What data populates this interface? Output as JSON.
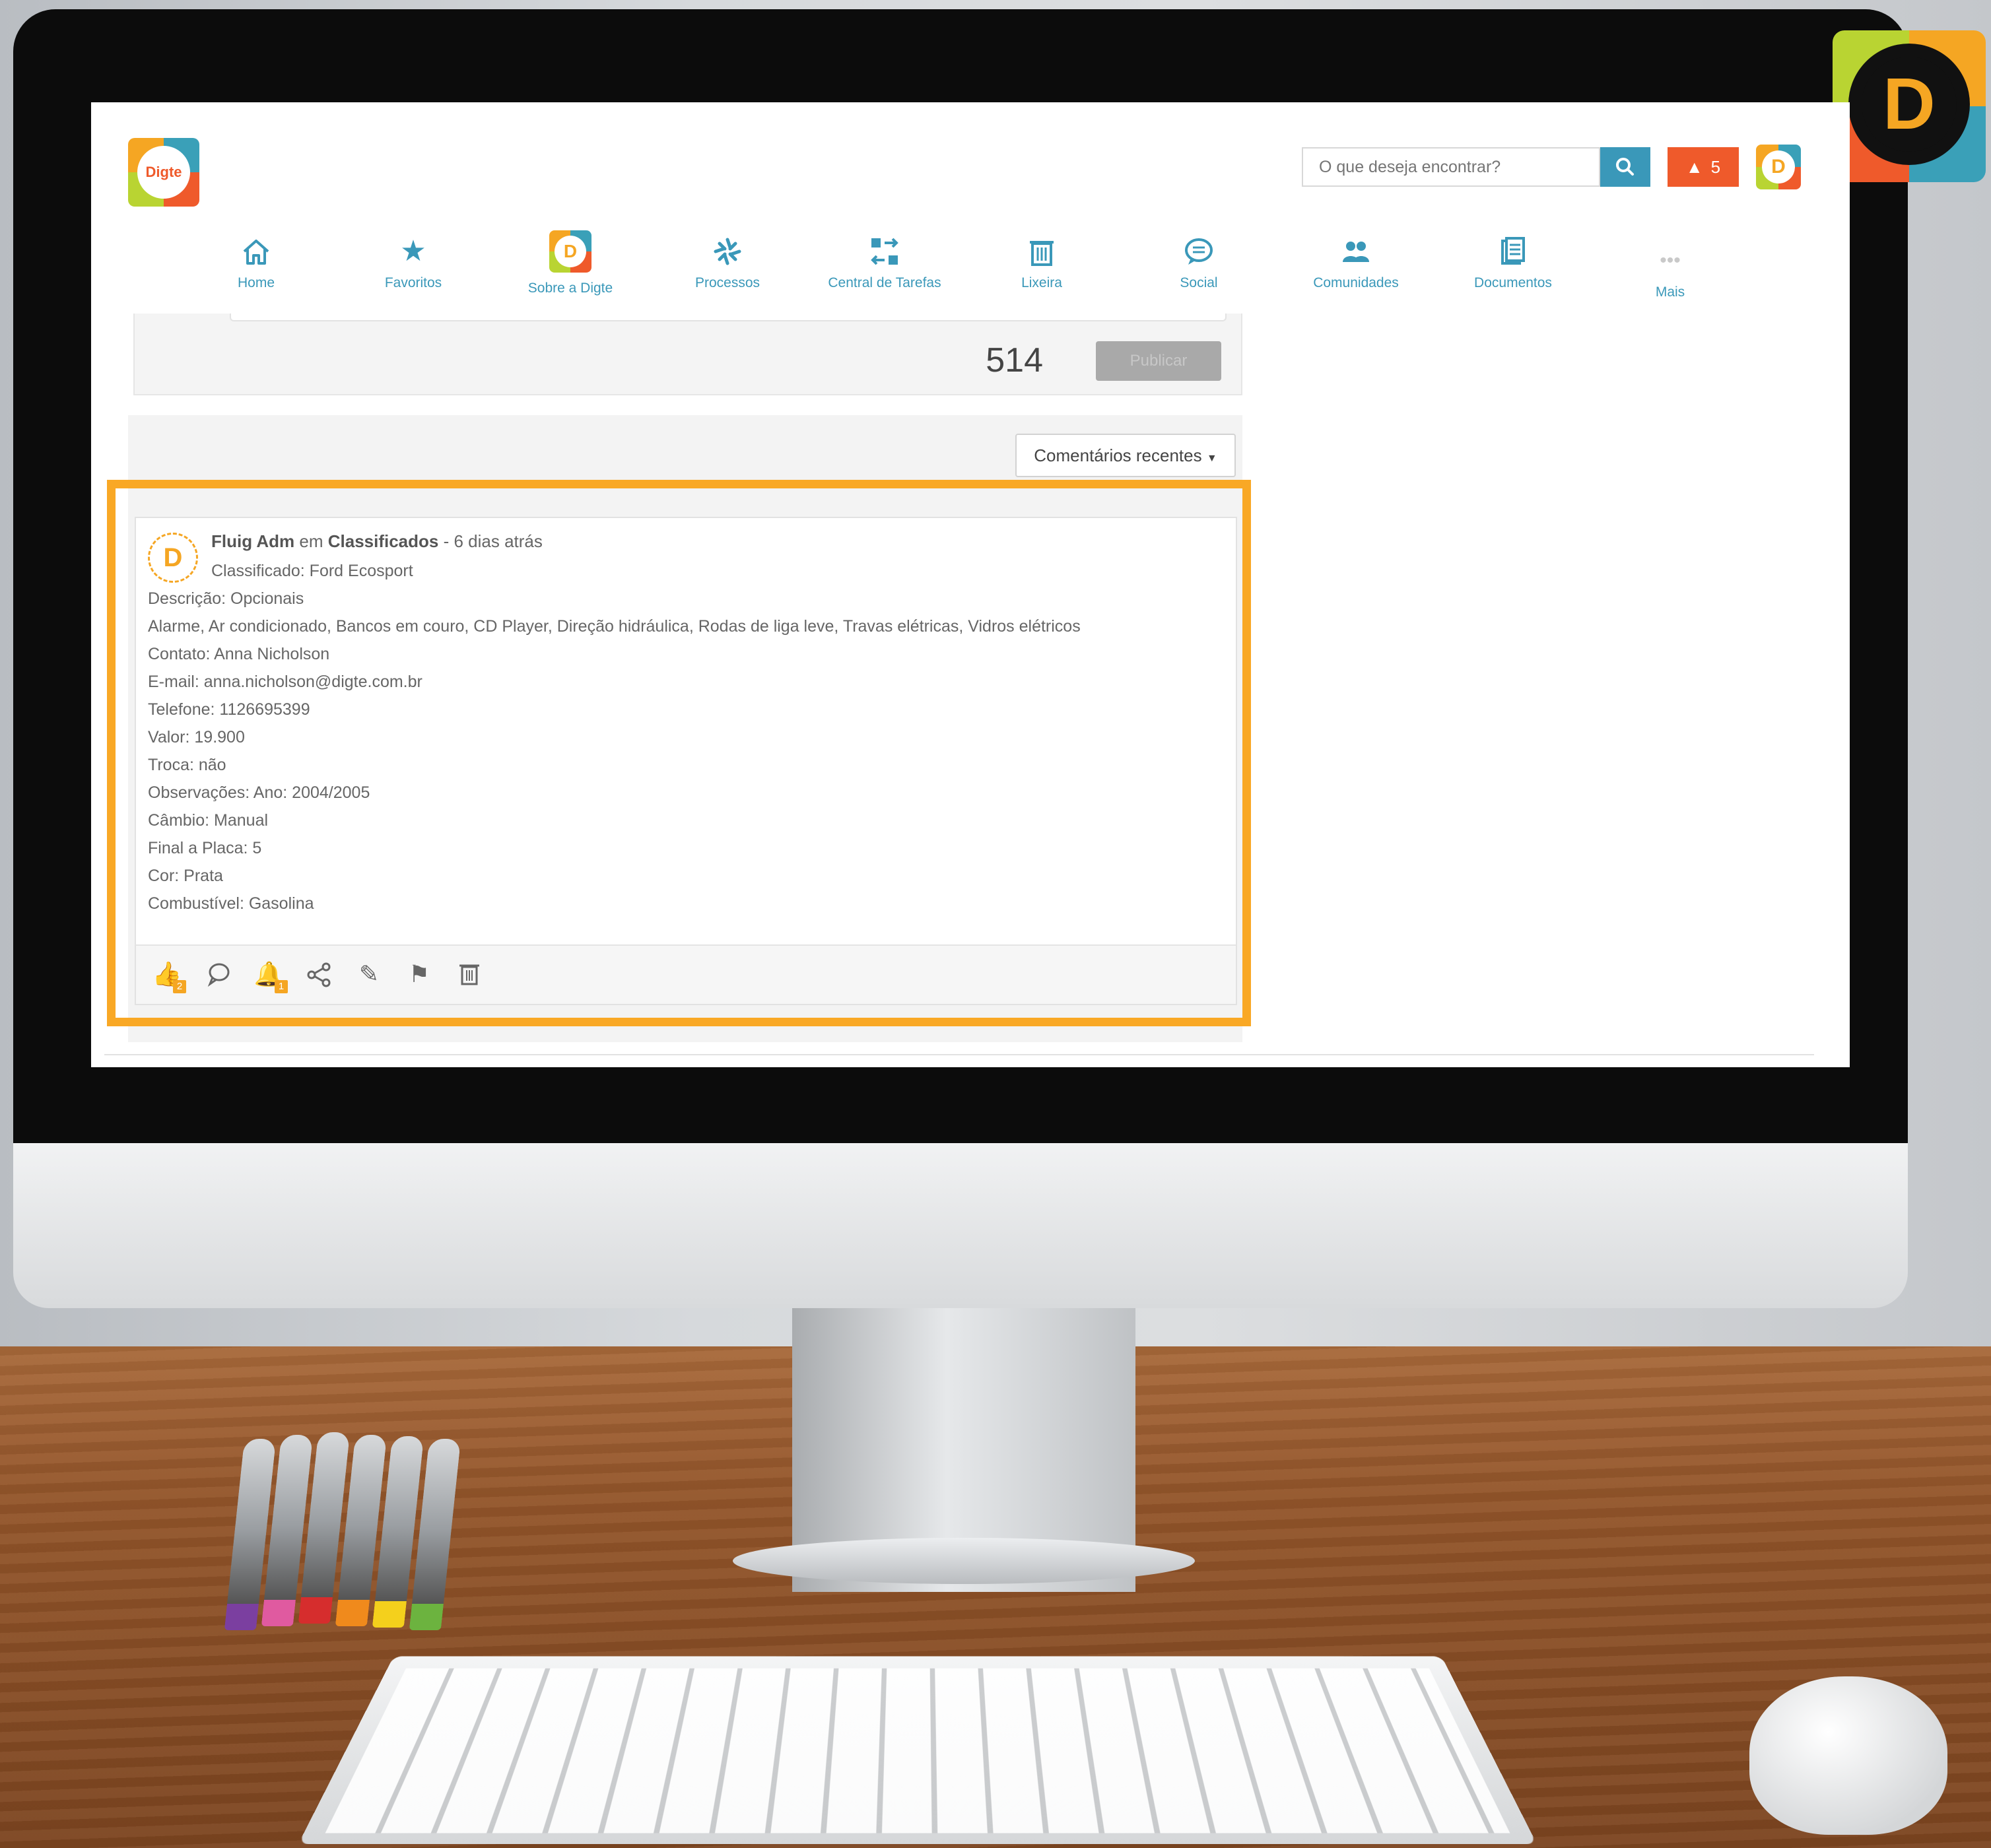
{
  "app": {
    "logo_text": "Digte",
    "corner_logo_letter": "D"
  },
  "search": {
    "placeholder": "O que deseja encontrar?"
  },
  "alerts": {
    "count": "5"
  },
  "user": {
    "avatar_letter": "D"
  },
  "nav": {
    "items": [
      {
        "label": "Home",
        "icon": "home-icon"
      },
      {
        "label": "Favoritos",
        "icon": "star-icon"
      },
      {
        "label": "Sobre a Digte",
        "icon": "digte-logo-icon"
      },
      {
        "label": "Processos",
        "icon": "processes-icon"
      },
      {
        "label": "Central de Tarefas",
        "icon": "task-center-icon"
      },
      {
        "label": "Lixeira",
        "icon": "trash-icon"
      },
      {
        "label": "Social",
        "icon": "chat-icon"
      },
      {
        "label": "Comunidades",
        "icon": "communities-icon"
      },
      {
        "label": "Documentos",
        "icon": "documents-icon"
      },
      {
        "label": "Mais",
        "icon": "more-icon"
      }
    ]
  },
  "composer": {
    "char_count": "514",
    "publish_label": "Publicar"
  },
  "feed": {
    "sort_label": "Comentários recentes"
  },
  "post": {
    "avatar_letter": "D",
    "author": "Fluig Adm",
    "connector": "em",
    "community": "Classificados",
    "time": "- 6 dias atrás",
    "lines": [
      "Classificado: Ford Ecosport",
      "Descrição: Opcionais",
      "Alarme, Ar condicionado, Bancos em couro, CD Player, Direção hidráulica, Rodas de liga leve, Travas elétricas, Vidros elétricos",
      "Contato: Anna Nicholson",
      "E-mail: anna.nicholson@digte.com.br",
      "Telefone: 1126695399",
      "Valor: 19.900",
      "Troca: não",
      "Observações: Ano: 2004/2005",
      "Câmbio: Manual",
      "Final a Placa: 5",
      "Cor: Prata",
      "Combustível: Gasolina"
    ],
    "actions": {
      "like_count": "2",
      "notify_count": "1"
    }
  },
  "colors": {
    "accent": "#3a98b9",
    "alert": "#ef5a2b",
    "highlight": "#f9a825"
  }
}
